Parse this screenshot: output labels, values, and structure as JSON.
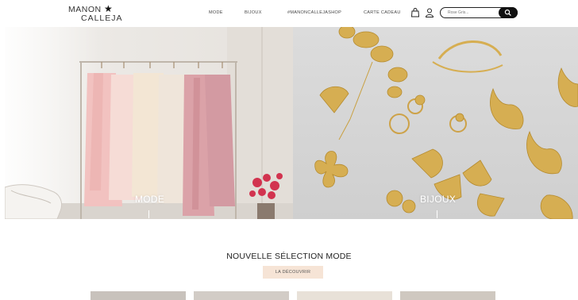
{
  "header": {
    "logo_line1": "MANON",
    "logo_line2": "CALLEJA",
    "nav": {
      "mode": "MODE",
      "bijoux": "BIJOUX",
      "hashtag": "#MANONCALLEJASHOP",
      "gift": "CARTE CADEAU"
    },
    "search_placeholder": "Rose Gris..."
  },
  "hero": {
    "left_label": "MODE",
    "right_label": "BIJOUX"
  },
  "section": {
    "title": "NOUVELLE SÉLECTION MODE",
    "cta": "LA DÉCOUVRIR"
  },
  "colors": {
    "cta_bg": "#f6e4d6",
    "search_button": "#111111",
    "gold": "#d6ae52"
  },
  "icons": [
    "star-icon",
    "bag-icon",
    "user-icon",
    "search-icon"
  ]
}
